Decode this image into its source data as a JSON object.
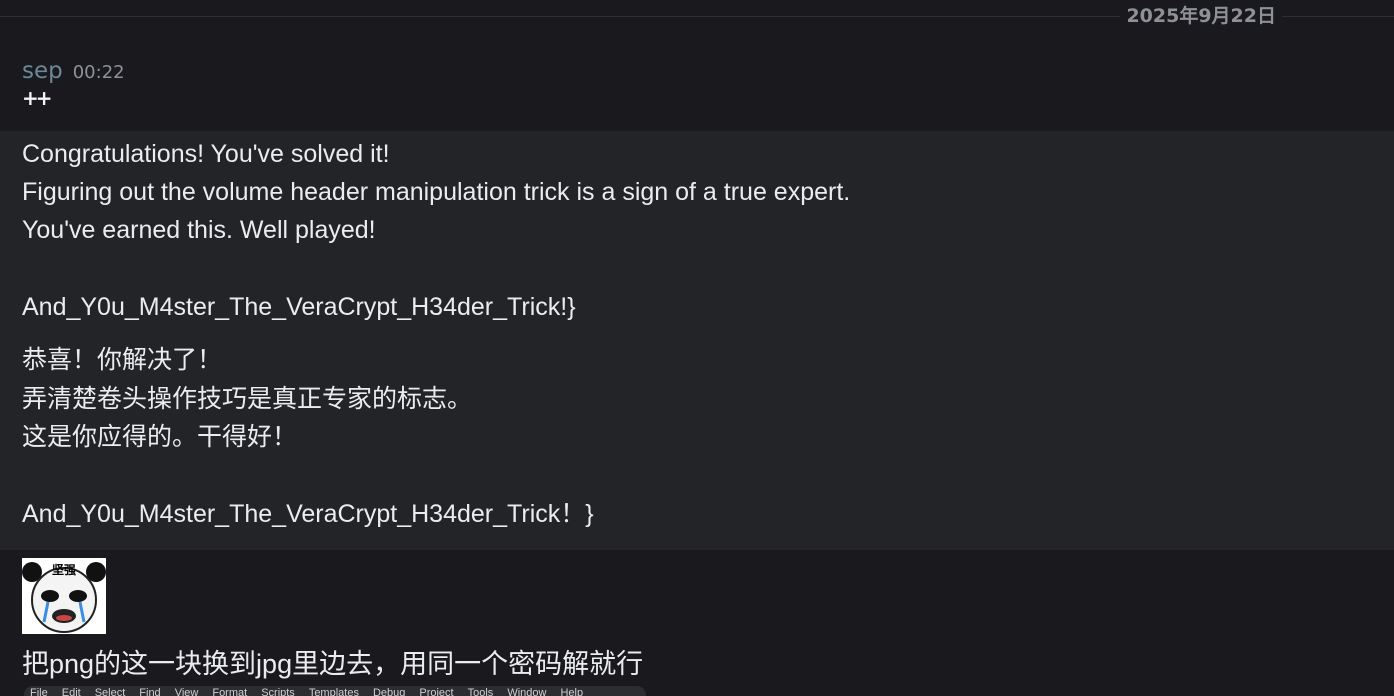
{
  "date_divider": "2025年9月22日",
  "message": {
    "author": "sep",
    "timestamp": "00:22",
    "marker": "++"
  },
  "quote": {
    "lines": [
      "Congratulations! You've solved it!",
      "Figuring out the volume header manipulation trick is a sign of a true expert.",
      "You've earned this. Well played!",
      "And_Y0u_M4ster_The_VeraCrypt_H34der_Trick!}",
      "恭喜！你解决了！",
      "弄清楚卷头操作技巧是真正专家的标志。",
      "这是你应得的。干得好！",
      "And_Y0u_M4ster_The_VeraCrypt_H34der_Trick！}"
    ]
  },
  "sticker": {
    "caption": "坚强",
    "icon": "crying-panda-sticker"
  },
  "reply": "把png的这一块换到jpg里边去，用同一个密码解就行",
  "menubar": {
    "items": [
      "File",
      "Edit",
      "Select",
      "Find",
      "View",
      "Format",
      "Scripts",
      "Templates",
      "Debug",
      "Project",
      "Tools",
      "Window",
      "Help"
    ]
  },
  "colors": {
    "background": "#1a1a1e",
    "quote_background": "#232428",
    "author": "#6d8896",
    "text": "#ebecef"
  }
}
